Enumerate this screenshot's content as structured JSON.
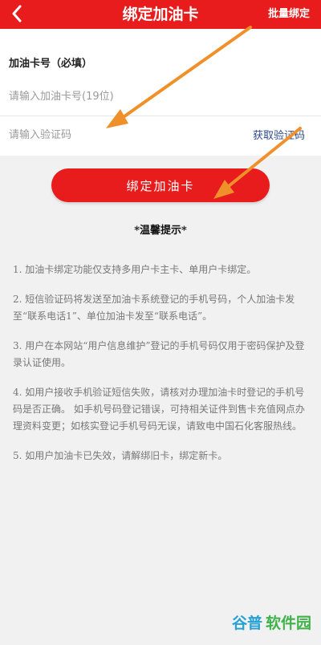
{
  "header": {
    "title": "绑定加油卡",
    "batch_label": "批量绑定",
    "back_icon": "chevron-left-icon"
  },
  "form": {
    "card_label": "加油卡号（必填）",
    "card_placeholder": "请输入加油卡号(19位)",
    "code_placeholder": "请输入验证码",
    "get_code_label": "获取验证码"
  },
  "bind_button": {
    "label": "绑定加油卡"
  },
  "tips": {
    "title": "*温馨提示*",
    "items": [
      "1. 加油卡绑定功能仅支持多用户卡主卡、单用户卡绑定。",
      "2. 短信验证码将发送至加油卡系统登记的手机号码，个人加油卡发至“联系电话1”、单位加油卡发至“联系电话”。",
      "3. 用户在本网站“用户信息维护”登记的手机号码仅用于密码保护及登录认证使用。",
      "4. 如用户接收手机验证短信失败，请核对办理加油卡时登记的手机号码是否正确。 如手机号码登记错误，可持相关证件到售卡充值网点办理资料变更；如核实登记手机号码无误，请致电中国石化客服热线。",
      "5. 如用户加油卡已失效，请解绑旧卡，绑定新卡。"
    ]
  },
  "watermark": {
    "main": "谷普",
    "sub": "软件园"
  },
  "colors": {
    "brand_red": "#e81c1c",
    "link_blue": "#2a4a8a",
    "arrow_orange": "#f0902a"
  }
}
